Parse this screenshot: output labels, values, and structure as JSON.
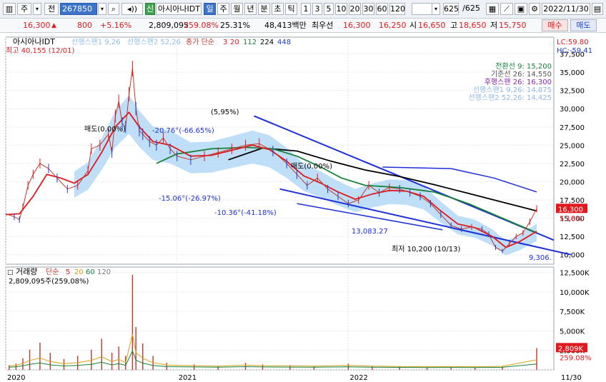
{
  "toolbar": {
    "period": "주",
    "mode": "전",
    "code_input": "267850",
    "credit_badge": "신",
    "stock_name": "아시아나IDT",
    "tabs": [
      "일",
      "주",
      "월",
      "년",
      "분",
      "초",
      "틱"
    ],
    "active_tab": "일",
    "intervals": [
      "1",
      "3",
      "5",
      "10",
      "20",
      "30",
      "60",
      "120"
    ],
    "page_counter": "625",
    "page_total": "/625",
    "date": "2022/11/30"
  },
  "quote": {
    "price": "16,300",
    "change": "800",
    "change_pct": "+5.16%",
    "volume": "2,809,095",
    "volume_ratio": "259.08%",
    "turnover": "25.31%",
    "amount": "48,413백만",
    "best_ask_label": "최우선",
    "best_ask": "16,300",
    "best_bid": "16,250",
    "open_label": "시",
    "open": "16,650",
    "high_label": "고",
    "high": "18,650",
    "low_label": "저",
    "low": "15,750",
    "buy_label": "매수",
    "sell_label": "매도"
  },
  "chart_data": {
    "type": "line",
    "price_panel": {
      "title": "아시아나IDT",
      "legend": [
        {
          "text": "선행스팬1 9,26",
          "color": "#8fc0ee"
        },
        {
          "text": "선행스팬2 52,26",
          "color": "#8fc0ee"
        },
        {
          "text": "종가 단순",
          "color": "#c0392b"
        },
        {
          "text": "3",
          "color": "#e0191f"
        },
        {
          "text": "20",
          "color": "#e0191f"
        },
        {
          "text": "112",
          "color": "#16813a"
        },
        {
          "text": "224",
          "color": "#000000"
        },
        {
          "text": "448",
          "color": "#1c3fd0"
        }
      ],
      "ichimoku": [
        {
          "text": "전환선 9: 15,200",
          "color": "#16813a"
        },
        {
          "text": "기준선 26: 14,550",
          "color": "#555555"
        },
        {
          "text": "후행스팬 26: 16,300",
          "color": "#8e24aa"
        },
        {
          "text": "선행스팬1 9,26: 14,875",
          "color": "#8fb9e8"
        },
        {
          "text": "선행스팬2 52,26: 14,425",
          "color": "#8fb9e8"
        }
      ],
      "y_ticks": [
        10000,
        12500,
        15000,
        17500,
        20000,
        22500,
        25000,
        27500,
        30000,
        32500,
        35000,
        37500
      ],
      "y_tick_labels": [
        "10,000",
        "12,500",
        "15,000",
        "17,500",
        "20,000",
        "22,500",
        "25,000",
        "27,500",
        "30,000",
        "32,500",
        "35,000",
        "37,500"
      ],
      "ylim": [
        8700,
        39800
      ],
      "lc": "LC:59.80",
      "hc": "HC:-59.41",
      "last_price_label": "16,300",
      "last_pct_label": "5.16%",
      "high_note": "최고 40,155 (12/01)",
      "low_note": "최저 10,200 (10/13)",
      "annotations": [
        "(5,95%)",
        "-20.76°(-66.65%)",
        "-15.06°(-26.97%)",
        "-10.36°(-41.18%)",
        "13,083.27",
        "9,306.",
        "매도(0.00%)",
        "매도(0.00%)"
      ],
      "price_series": [
        [
          2020.0,
          15600
        ],
        [
          2020.05,
          15200
        ],
        [
          2020.08,
          14800
        ],
        [
          2020.1,
          16500
        ],
        [
          2020.13,
          19500
        ],
        [
          2020.16,
          21000
        ],
        [
          2020.2,
          22500
        ],
        [
          2020.25,
          21800
        ],
        [
          2020.3,
          20500
        ],
        [
          2020.36,
          19000
        ],
        [
          2020.42,
          19500
        ],
        [
          2020.48,
          21500
        ],
        [
          2020.5,
          24500
        ],
        [
          2020.55,
          25000
        ],
        [
          2020.6,
          26500
        ],
        [
          2020.62,
          24000
        ],
        [
          2020.64,
          29000
        ],
        [
          2020.66,
          31000
        ],
        [
          2020.68,
          28000
        ],
        [
          2020.7,
          27500
        ],
        [
          2020.72,
          32000
        ],
        [
          2020.74,
          35500
        ],
        [
          2020.76,
          30000
        ],
        [
          2020.78,
          27000
        ],
        [
          2020.8,
          26500
        ],
        [
          2020.84,
          25500
        ],
        [
          2020.88,
          25000
        ],
        [
          2020.92,
          26000
        ],
        [
          2020.96,
          24500
        ],
        [
          2021.0,
          23500
        ],
        [
          2021.08,
          23000
        ],
        [
          2021.16,
          23500
        ],
        [
          2021.24,
          24000
        ],
        [
          2021.32,
          24500
        ],
        [
          2021.4,
          25000
        ],
        [
          2021.48,
          25200
        ],
        [
          2021.56,
          24200
        ],
        [
          2021.64,
          22500
        ],
        [
          2021.7,
          21000
        ],
        [
          2021.76,
          19500
        ],
        [
          2021.82,
          20500
        ],
        [
          2021.88,
          19000
        ],
        [
          2021.94,
          18000
        ],
        [
          2022.0,
          17000
        ],
        [
          2022.06,
          17500
        ],
        [
          2022.12,
          19500
        ],
        [
          2022.18,
          18500
        ],
        [
          2022.24,
          19200
        ],
        [
          2022.3,
          19000
        ],
        [
          2022.36,
          18500
        ],
        [
          2022.42,
          18000
        ],
        [
          2022.48,
          17000
        ],
        [
          2022.54,
          15500
        ],
        [
          2022.6,
          14000
        ],
        [
          2022.66,
          13500
        ],
        [
          2022.72,
          13800
        ],
        [
          2022.78,
          13500
        ],
        [
          2022.82,
          12800
        ],
        [
          2022.86,
          11000
        ],
        [
          2022.9,
          10500
        ],
        [
          2022.94,
          11500
        ],
        [
          2022.98,
          12500
        ],
        [
          2023.02,
          13000
        ],
        [
          2023.06,
          14500
        ],
        [
          2023.1,
          16300
        ]
      ],
      "ma20_series": [
        [
          2020.0,
          15500
        ],
        [
          2020.08,
          15600
        ],
        [
          2020.16,
          18000
        ],
        [
          2020.24,
          21000
        ],
        [
          2020.32,
          20500
        ],
        [
          2020.4,
          19800
        ],
        [
          2020.48,
          21000
        ],
        [
          2020.56,
          24000
        ],
        [
          2020.64,
          27500
        ],
        [
          2020.72,
          29500
        ],
        [
          2020.78,
          27500
        ],
        [
          2020.86,
          25500
        ],
        [
          2020.96,
          25000
        ],
        [
          2021.08,
          23500
        ],
        [
          2021.2,
          23600
        ],
        [
          2021.32,
          24300
        ],
        [
          2021.44,
          25000
        ],
        [
          2021.54,
          24400
        ],
        [
          2021.64,
          22800
        ],
        [
          2021.74,
          20800
        ],
        [
          2021.84,
          19800
        ],
        [
          2021.94,
          18600
        ],
        [
          2022.04,
          17600
        ],
        [
          2022.14,
          18300
        ],
        [
          2022.24,
          18800
        ],
        [
          2022.34,
          18700
        ],
        [
          2022.44,
          18000
        ],
        [
          2022.54,
          16000
        ],
        [
          2022.64,
          14200
        ],
        [
          2022.74,
          13700
        ],
        [
          2022.84,
          12500
        ],
        [
          2022.92,
          11000
        ],
        [
          2023.0,
          11800
        ],
        [
          2023.1,
          13200
        ]
      ],
      "ma112_series": [
        [
          2020.88,
          22500
        ],
        [
          2021.0,
          23800
        ],
        [
          2021.2,
          24500
        ],
        [
          2021.4,
          24700
        ],
        [
          2021.56,
          24500
        ],
        [
          2021.7,
          23500
        ],
        [
          2021.84,
          22000
        ],
        [
          2021.96,
          20500
        ],
        [
          2022.1,
          19500
        ],
        [
          2022.3,
          19200
        ],
        [
          2022.5,
          18600
        ],
        [
          2022.7,
          17000
        ],
        [
          2022.9,
          15000
        ],
        [
          2023.1,
          13000
        ]
      ],
      "ma224_series": [
        [
          2021.3,
          23000
        ],
        [
          2021.5,
          24600
        ],
        [
          2021.7,
          24200
        ],
        [
          2021.9,
          22800
        ],
        [
          2022.1,
          21600
        ],
        [
          2022.3,
          20700
        ],
        [
          2022.5,
          19600
        ],
        [
          2022.7,
          18400
        ],
        [
          2022.9,
          17200
        ],
        [
          2023.1,
          16000
        ]
      ],
      "channel_upper": [
        [
          2021.45,
          29000
        ],
        [
          2023.2,
          12000
        ]
      ],
      "channel_lower": [
        [
          2021.6,
          19000
        ],
        [
          2023.3,
          10000
        ]
      ],
      "channel_mid": [
        [
          2021.7,
          17000
        ],
        [
          2022.55,
          13400
        ]
      ],
      "blue_arc": [
        [
          2022.2,
          22000
        ],
        [
          2022.6,
          21800
        ],
        [
          2022.85,
          20500
        ],
        [
          2023.1,
          18600
        ]
      ]
    },
    "volume_panel": {
      "title": "거래량",
      "legend": [
        {
          "text": "단순",
          "color": "#c0392b"
        },
        {
          "text": "5",
          "color": "#e0191f"
        },
        {
          "text": "20",
          "color": "#d4a017"
        },
        {
          "text": "60",
          "color": "#16813a"
        },
        {
          "text": "120",
          "color": "#777777"
        }
      ],
      "current_label": "2,809,095주(259,08%)",
      "y_ticks": [
        0,
        2500000,
        5000000,
        7500000,
        10000000,
        12500000
      ],
      "y_tick_labels": [
        "",
        "2,500K",
        "5,000K",
        "7,500K",
        "10,000K",
        "12,500K"
      ],
      "ylim": [
        0,
        13200000
      ],
      "last_vol_label": "2,809K",
      "last_vol_pct": "259.08%",
      "spikes": [
        [
          2020.02,
          600000
        ],
        [
          2020.06,
          800000
        ],
        [
          2020.1,
          1500000
        ],
        [
          2020.14,
          2600000
        ],
        [
          2020.2,
          3500000
        ],
        [
          2020.26,
          2200000
        ],
        [
          2020.34,
          1400000
        ],
        [
          2020.42,
          1800000
        ],
        [
          2020.5,
          2600000
        ],
        [
          2020.56,
          4000000
        ],
        [
          2020.62,
          2200000
        ],
        [
          2020.66,
          3000000
        ],
        [
          2020.7,
          1800000
        ],
        [
          2020.74,
          12200000
        ],
        [
          2020.76,
          5500000
        ],
        [
          2020.8,
          3400000
        ],
        [
          2020.86,
          1800000
        ],
        [
          2020.94,
          900000
        ],
        [
          2021.1,
          700000
        ],
        [
          2021.24,
          500000
        ],
        [
          2021.4,
          900000
        ],
        [
          2021.5,
          700000
        ],
        [
          2021.66,
          600000
        ],
        [
          2021.8,
          500000
        ],
        [
          2022.0,
          800000
        ],
        [
          2022.14,
          500000
        ],
        [
          2022.3,
          400000
        ],
        [
          2022.46,
          300000
        ],
        [
          2022.6,
          350000
        ],
        [
          2022.74,
          300000
        ],
        [
          2022.9,
          450000
        ],
        [
          2023.1,
          2809095
        ]
      ]
    },
    "x_ticks": [
      2020.0,
      2021.0,
      2022.0
    ],
    "x_tick_labels": [
      "2020",
      "2021",
      "2022"
    ],
    "x_last_label": "11/30",
    "xlim": [
      2020.0,
      2023.2
    ]
  }
}
